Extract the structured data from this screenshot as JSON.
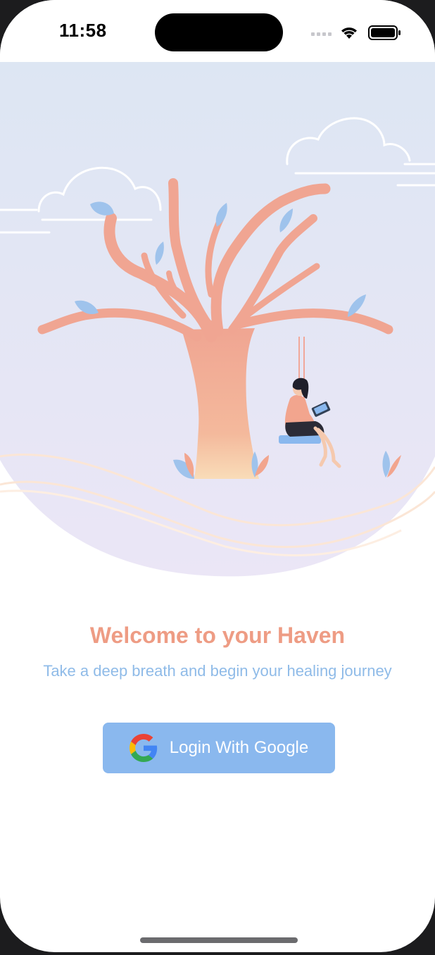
{
  "status_bar": {
    "time": "11:58",
    "icons": [
      "cellular-signal-icon",
      "wifi-icon",
      "battery-icon"
    ]
  },
  "hero": {
    "illustration": "tree-with-swing-reader-illustration"
  },
  "welcome": {
    "title": "Welcome to your Haven",
    "subtitle": "Take a deep breath and begin your healing journey"
  },
  "login_button": {
    "label": "Login With Google",
    "icon": "google-logo-icon"
  },
  "colors": {
    "title": "#ee9c84",
    "subtitle": "#8fbbe8",
    "button": "#8ab8ee",
    "tree": "#f2a58e",
    "leaf": "#9fc3ec"
  }
}
